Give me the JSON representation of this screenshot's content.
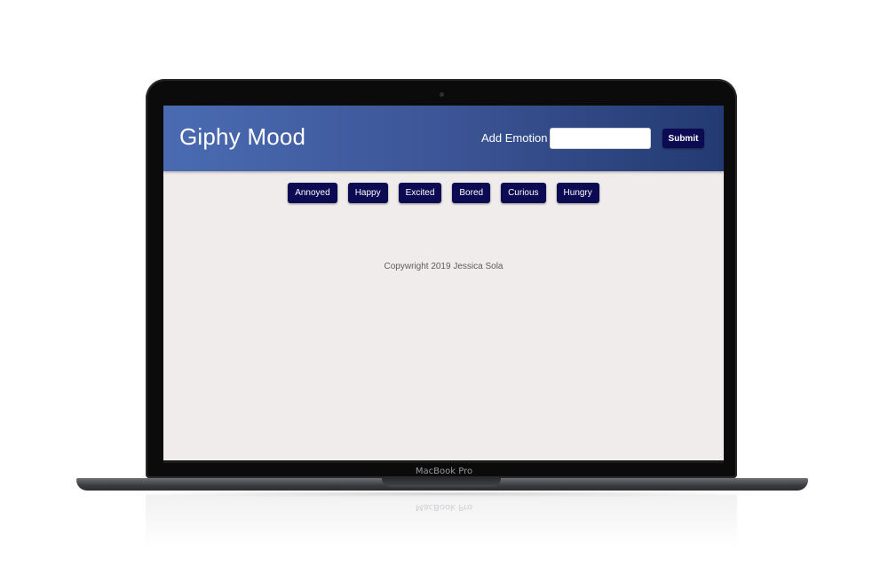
{
  "device": {
    "label": "MacBook Pro"
  },
  "app": {
    "title": "Giphy Mood",
    "add_emotion_label": "Add Emotion",
    "input_value": "",
    "input_placeholder": "",
    "submit_label": "Submit",
    "emotions": [
      "Annoyed",
      "Happy",
      "Excited",
      "Bored",
      "Curious",
      "Hungry"
    ],
    "footer": "Copywright 2019 Jessica Sola"
  },
  "colors": {
    "header_gradient_start": "#4a6bb2",
    "header_gradient_end": "#233a72",
    "button_bg": "#0c0a52",
    "page_bg": "#f1ecec"
  }
}
